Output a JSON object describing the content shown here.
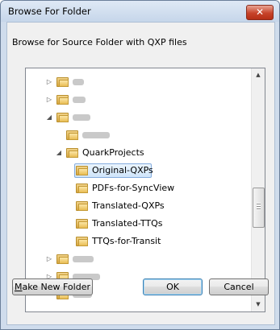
{
  "window": {
    "title": "Browse For Folder",
    "close_label": "✕"
  },
  "prompt": "Browse for Source Folder with QXP files",
  "tree": {
    "items": [
      {
        "label": "",
        "blurred": true,
        "expander": "▷",
        "indent": 0
      },
      {
        "label": "",
        "blurred": true,
        "expander": "▷",
        "indent": 0
      },
      {
        "label": "",
        "blurred": true,
        "expander": "◢",
        "indent": 0
      },
      {
        "label": "",
        "blurred": true,
        "expander": "",
        "indent": 1
      },
      {
        "label": "QuarkProjects",
        "blurred": false,
        "expander": "◢",
        "indent": 1
      },
      {
        "label": "Original-QXPs",
        "blurred": false,
        "expander": "",
        "indent": 2,
        "selected": true
      },
      {
        "label": "PDFs-for-SyncView",
        "blurred": false,
        "expander": "",
        "indent": 2
      },
      {
        "label": "Translated-QXPs",
        "blurred": false,
        "expander": "",
        "indent": 2
      },
      {
        "label": "Translated-TTQs",
        "blurred": false,
        "expander": "",
        "indent": 2
      },
      {
        "label": "TTQs-for-Transit",
        "blurred": false,
        "expander": "",
        "indent": 2
      },
      {
        "label": "",
        "blurred": true,
        "expander": "▷",
        "indent": 0
      },
      {
        "label": "",
        "blurred": true,
        "expander": "▷",
        "indent": 0
      },
      {
        "label": "",
        "blurred": true,
        "expander": "",
        "indent": 0
      }
    ]
  },
  "buttons": {
    "make_new_folder_first": "M",
    "make_new_folder_rest": "ake New Folder",
    "ok": "OK",
    "cancel": "Cancel"
  }
}
